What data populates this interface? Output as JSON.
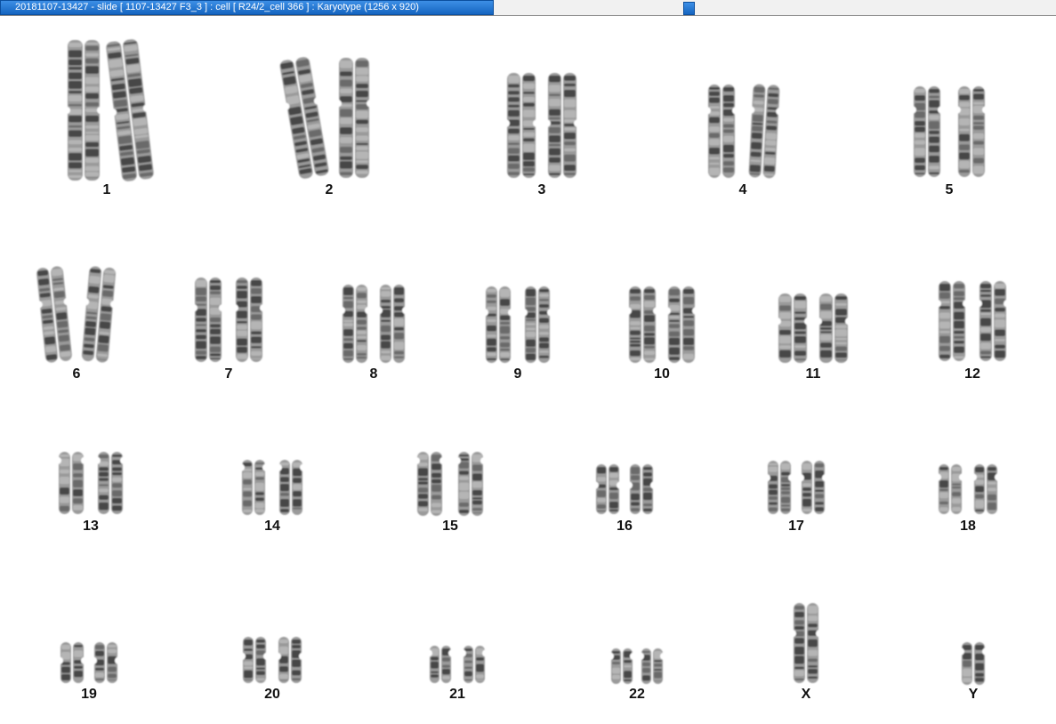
{
  "window": {
    "title": "20181107-13427 - slide [ 1107-13427 F3_3 ] : cell [ R24/2_cell 366 ] : Karyotype  (1256 x 920)"
  },
  "karyotype": {
    "chromosomes": [
      {
        "id": "1",
        "label": "1"
      },
      {
        "id": "2",
        "label": "2"
      },
      {
        "id": "3",
        "label": "3"
      },
      {
        "id": "4",
        "label": "4"
      },
      {
        "id": "5",
        "label": "5"
      },
      {
        "id": "6",
        "label": "6"
      },
      {
        "id": "7",
        "label": "7"
      },
      {
        "id": "8",
        "label": "8"
      },
      {
        "id": "9",
        "label": "9"
      },
      {
        "id": "10",
        "label": "10"
      },
      {
        "id": "11",
        "label": "11"
      },
      {
        "id": "12",
        "label": "12"
      },
      {
        "id": "13",
        "label": "13"
      },
      {
        "id": "14",
        "label": "14"
      },
      {
        "id": "15",
        "label": "15"
      },
      {
        "id": "16",
        "label": "16"
      },
      {
        "id": "17",
        "label": "17"
      },
      {
        "id": "18",
        "label": "18"
      },
      {
        "id": "19",
        "label": "19"
      },
      {
        "id": "20",
        "label": "20"
      },
      {
        "id": "21",
        "label": "21"
      },
      {
        "id": "22",
        "label": "22"
      },
      {
        "id": "X",
        "label": "X"
      },
      {
        "id": "Y",
        "label": "Y"
      }
    ]
  }
}
